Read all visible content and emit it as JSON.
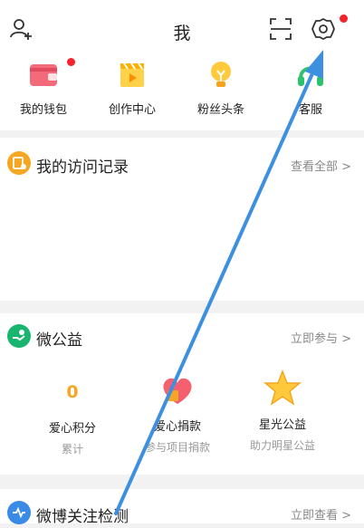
{
  "header": {
    "title": "我"
  },
  "shortcuts": [
    {
      "label": "我的钱包",
      "icon": "wallet-icon"
    },
    {
      "label": "创作中心",
      "icon": "clapperboard-icon"
    },
    {
      "label": "粉丝头条",
      "icon": "lightbulb-icon"
    },
    {
      "label": "客服",
      "icon": "headset-icon"
    }
  ],
  "visits": {
    "title": "我的访问记录",
    "more": "查看全部 >"
  },
  "charity": {
    "title": "微公益",
    "more": "立即参与 >",
    "items": [
      {
        "value": "0",
        "label": "爱心积分",
        "sub": "累计"
      },
      {
        "label": "爱心捐款",
        "sub": "参与项目捐款"
      },
      {
        "label": "星光公益",
        "sub": "助力明星公益"
      }
    ]
  },
  "weibo_check": {
    "title": "微博关注检测",
    "more": "立即查看 >"
  },
  "colors": {
    "accent": "#f5222d",
    "arrow": "#3d8fe0",
    "orange": "#f5a623",
    "green": "#19b56f",
    "blue": "#3b8be6"
  }
}
